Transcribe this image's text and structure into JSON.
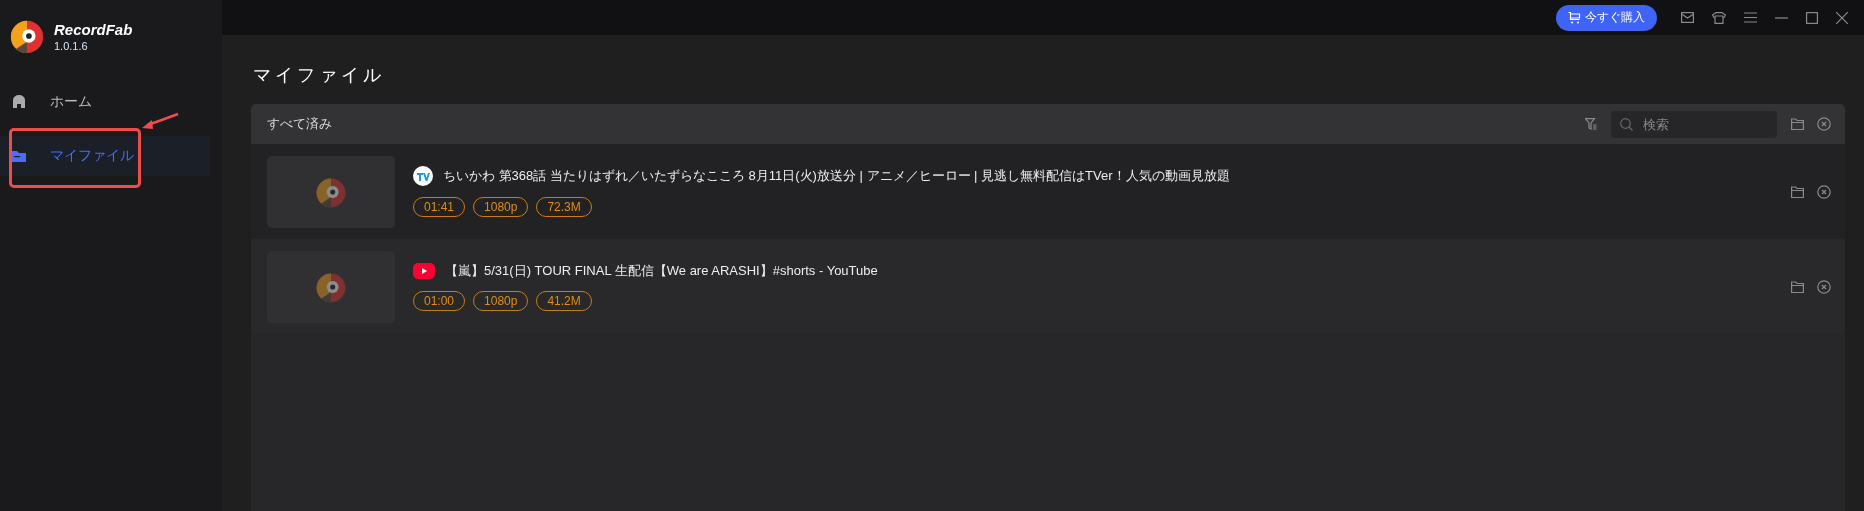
{
  "app": {
    "name": "RecordFab",
    "version": "1.0.1.6"
  },
  "nav": [
    {
      "label": "ホーム",
      "kind": "home",
      "selected": false,
      "highlighted": false
    },
    {
      "label": "マイファイル",
      "kind": "folder",
      "selected": true,
      "highlighted": true
    }
  ],
  "topbar": {
    "buy_button": "今すぐ購入"
  },
  "page": {
    "title": "マイファイル"
  },
  "list_header": {
    "label": "すべて済み",
    "search": {
      "placeholder": "検索"
    }
  },
  "files": [
    {
      "kind": "tver",
      "title": "ちいかわ 第368話 当たりはずれ／いたずらなこころ 8月11日(火)放送分 | アニメ／ヒーロー | 見逃し無料配信はTVer！人気の動画見放題",
      "tags": [
        "01:41",
        "1080p",
        "72.3M"
      ]
    },
    {
      "kind": "youtube",
      "title": "【嵐】5/31(日) TOUR FINAL 生配信【We are ARASHI】#shorts - YouTube",
      "tags": [
        "01:00",
        "1080p",
        "41.2M"
      ]
    }
  ]
}
